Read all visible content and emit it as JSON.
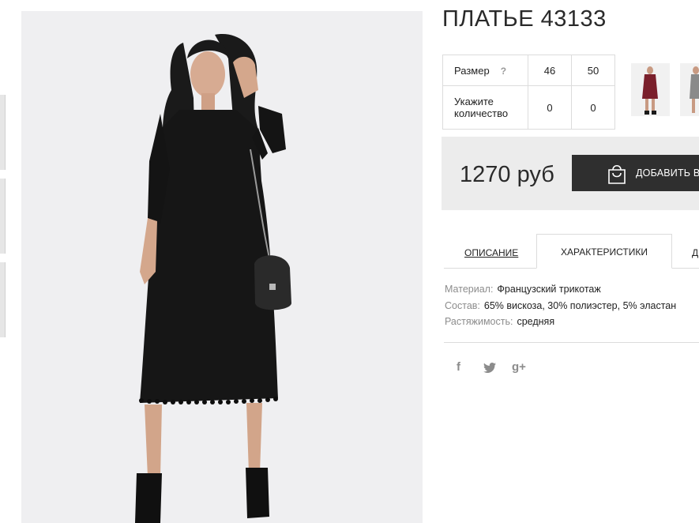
{
  "product": {
    "title": "ПЛАТЬЕ 43133"
  },
  "size_table": {
    "size_label": "Размер",
    "help": "?",
    "sizes": [
      "46",
      "50"
    ],
    "quantity_label_line1": "Укажите",
    "quantity_label_line2": "количество",
    "quantities": [
      "0",
      "0"
    ]
  },
  "purchase": {
    "price": "1270 руб",
    "add_button_label": "ДОБАВИТЬ В",
    "bag_icon": "shopping-bag-icon"
  },
  "tabs": [
    {
      "label": "ОПИСАНИЕ",
      "active": false
    },
    {
      "label": "ХАРАКТЕРИСТИКИ",
      "active": true
    },
    {
      "label": "Д",
      "active": false
    }
  ],
  "specs": [
    {
      "key": "Материал:",
      "value": "Французский трикотаж"
    },
    {
      "key": "Состав:",
      "value": "65% вискоза, 30% полиэстер, 5% эластан"
    },
    {
      "key": "Растяжимость:",
      "value": "средняя"
    }
  ],
  "social": [
    {
      "icon": "facebook-icon",
      "glyph": "f"
    },
    {
      "icon": "twitter-icon",
      "glyph": "t"
    },
    {
      "icon": "google-plus-icon",
      "glyph": "g+"
    }
  ],
  "colors": {
    "button_bg": "#2f2f2f",
    "price_bg": "#ececec",
    "photo_bg": "#efeff1",
    "muted_text": "#8c8c8c"
  }
}
